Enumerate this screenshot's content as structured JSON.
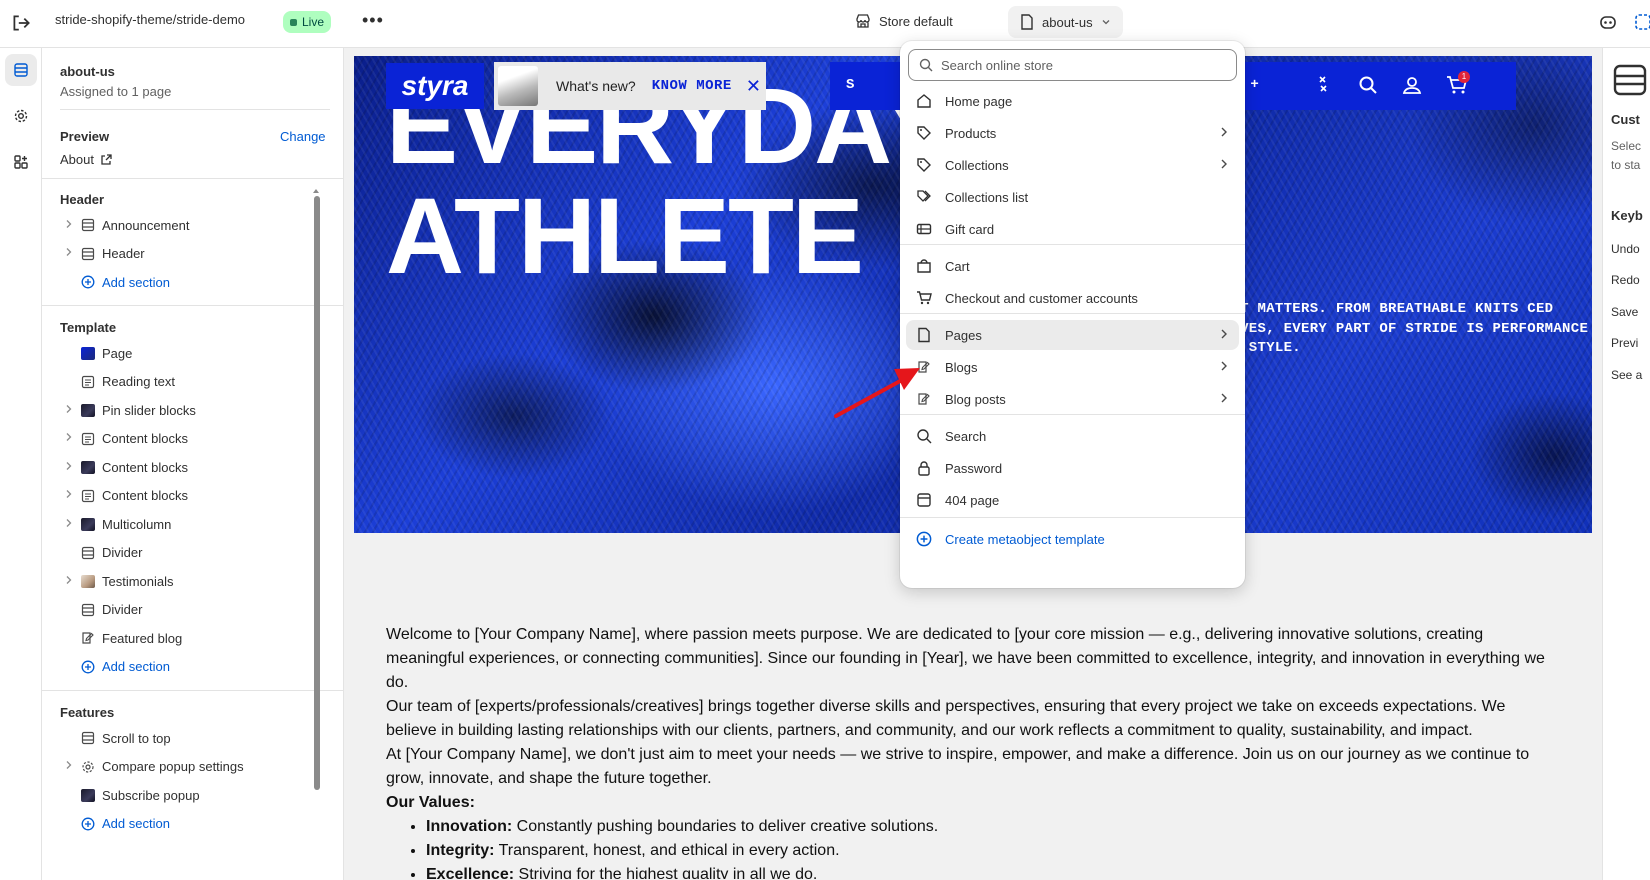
{
  "topbar": {
    "store_path": "stride-shopify-theme/stride-demo",
    "live_badge": "Live",
    "more": "•••",
    "theme_selector": "Store default",
    "page_selector": "about-us"
  },
  "sidebar": {
    "title": "about-us",
    "subtitle": "Assigned to 1 page",
    "preview_label": "Preview",
    "change_label": "Change",
    "preview_value": "About",
    "header_group": "Header",
    "header_items": [
      {
        "label": "Announcement",
        "icon": "section-icon",
        "expandable": true
      },
      {
        "label": "Header",
        "icon": "section-icon",
        "expandable": true
      }
    ],
    "add_section": "Add section",
    "template_group": "Template",
    "template_items": [
      {
        "label": "Page",
        "icon": "page-thumb",
        "expandable": false
      },
      {
        "label": "Reading text",
        "icon": "text-icon",
        "expandable": false
      },
      {
        "label": "Pin slider blocks",
        "icon": "image-thumb",
        "expandable": true
      },
      {
        "label": "Content blocks",
        "icon": "text-icon",
        "expandable": true
      },
      {
        "label": "Content blocks",
        "icon": "image-thumb",
        "expandable": true
      },
      {
        "label": "Content blocks",
        "icon": "text-icon",
        "expandable": true
      },
      {
        "label": "Multicolumn",
        "icon": "image-thumb",
        "expandable": true
      },
      {
        "label": "Divider",
        "icon": "section-icon",
        "expandable": false
      },
      {
        "label": "Testimonials",
        "icon": "person-thumb",
        "expandable": true
      },
      {
        "label": "Divider",
        "icon": "section-icon",
        "expandable": false
      },
      {
        "label": "Featured blog",
        "icon": "blog-icon",
        "expandable": false
      }
    ],
    "features_group": "Features",
    "features_items": [
      {
        "label": "Scroll to top",
        "icon": "section-icon",
        "expandable": false
      },
      {
        "label": "Compare popup settings",
        "icon": "gear-icon",
        "expandable": true
      },
      {
        "label": "Subscribe popup",
        "icon": "image-thumb",
        "expandable": false
      }
    ]
  },
  "preview": {
    "hero_line1": "EVERYDAY",
    "hero_line2": "ATHLETE",
    "hero_copy": "WHAT MATTERS. FROM BREATHABLE KNITS CED WEAVES, EVERY PART OF STRIDE IS PERFORMANCE AND STYLE.",
    "logo": "styra",
    "news_question": "What's new?",
    "news_link": "KNOW MORE",
    "nav_partial_s": "S",
    "nav_explore": "PLORE +",
    "cart_count": "1",
    "paragraph1": "Welcome to [Your Company Name], where passion meets purpose. We are dedicated to [your core mission — e.g., delivering innovative solutions, creating meaningful experiences, or connecting communities]. Since our founding in [Year], we have been committed to excellence, integrity, and innovation in everything we do.",
    "paragraph2": "Our team of [experts/professionals/creatives] brings together diverse skills and perspectives, ensuring that every project we take on exceeds expectations. We believe in building lasting relationships with our clients, partners, and community, and our work reflects a commitment to quality, sustainability, and impact.",
    "paragraph3": "At [Your Company Name], we don't just aim to meet your needs — we strive to inspire, empower, and make a difference. Join us on our journey as we continue to grow, innovate, and shape the future together.",
    "values_heading": "Our Values:",
    "values": [
      {
        "term": "Innovation:",
        "desc": "Constantly pushing boundaries to deliver creative solutions."
      },
      {
        "term": "Integrity:",
        "desc": "Transparent, honest, and ethical in every action."
      },
      {
        "term": "Excellence:",
        "desc": "Striving for the highest quality in all we do."
      }
    ]
  },
  "right_panel": {
    "items": [
      "Cust",
      "Selec",
      "to sta",
      "Keyb",
      "Undo",
      "Redo",
      "Save",
      "Previ",
      "See a"
    ]
  },
  "dropdown": {
    "search_placeholder": "Search online store",
    "groups": [
      [
        {
          "label": "Home page",
          "icon": "home-icon",
          "has_submenu": false
        },
        {
          "label": "Products",
          "icon": "tag-icon",
          "has_submenu": true
        },
        {
          "label": "Collections",
          "icon": "tag-icon",
          "has_submenu": true
        },
        {
          "label": "Collections list",
          "icon": "tags-icon",
          "has_submenu": false
        },
        {
          "label": "Gift card",
          "icon": "gift-card-icon",
          "has_submenu": false
        }
      ],
      [
        {
          "label": "Cart",
          "icon": "bag-icon",
          "has_submenu": false
        },
        {
          "label": "Checkout and customer accounts",
          "icon": "cart-icon",
          "has_submenu": false
        }
      ],
      [
        {
          "label": "Pages",
          "icon": "page-icon",
          "has_submenu": true,
          "selected": true
        },
        {
          "label": "Blogs",
          "icon": "blog-icon",
          "has_submenu": true
        },
        {
          "label": "Blog posts",
          "icon": "blog-icon",
          "has_submenu": true
        }
      ],
      [
        {
          "label": "Search",
          "icon": "search-icon",
          "has_submenu": false
        },
        {
          "label": "Password",
          "icon": "lock-icon",
          "has_submenu": false
        },
        {
          "label": "404 page",
          "icon": "store-icon",
          "has_submenu": false
        }
      ]
    ],
    "create_label": "Create metaobject template"
  },
  "colors": {
    "accent_blue": "#005bd3",
    "brand_blue": "#0a23d6",
    "live_green": "#affebf",
    "annotation_red": "#e5161b"
  }
}
